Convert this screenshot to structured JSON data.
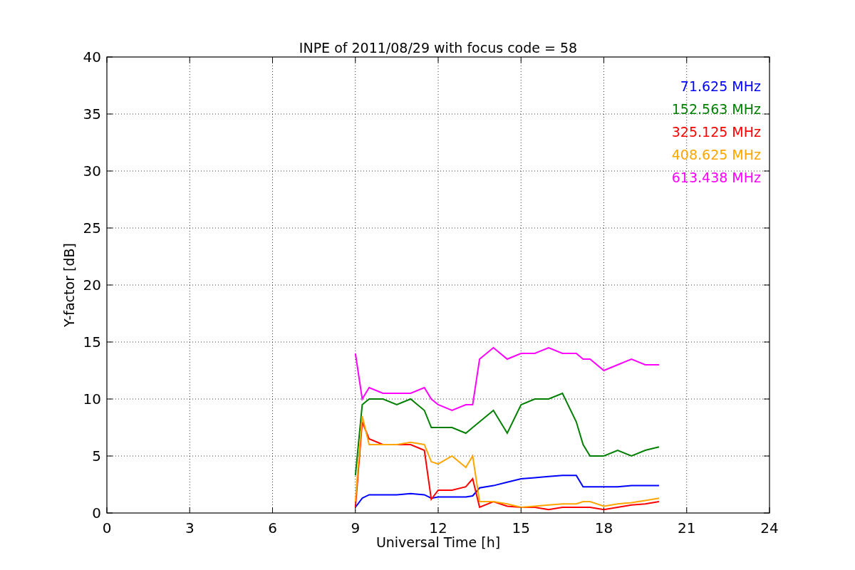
{
  "figure": {
    "chart_data": {
      "type": "line",
      "title": "INPE of 2011/08/29 with focus code = 58",
      "xlabel": "Universal Time [h]",
      "ylabel": "Y-factor [dB]",
      "x": [
        9,
        9.25,
        9.5,
        10,
        10.5,
        11,
        11.5,
        11.75,
        12,
        12.5,
        13,
        13.25,
        13.5,
        14,
        14.5,
        15,
        15.5,
        16,
        16.5,
        17,
        17.25,
        17.5,
        18,
        18.5,
        19,
        19.5,
        20
      ],
      "series": [
        {
          "name": "71.625 MHz",
          "color": "#0000ff",
          "values": [
            0.5,
            1.3,
            1.6,
            1.6,
            1.6,
            1.7,
            1.6,
            1.3,
            1.4,
            1.4,
            1.4,
            1.5,
            2.2,
            2.4,
            2.7,
            3.0,
            3.1,
            3.2,
            3.3,
            3.3,
            2.3,
            2.3,
            2.3,
            2.3,
            2.4,
            2.4,
            2.4
          ]
        },
        {
          "name": "152.563 MHz",
          "color": "#008000",
          "values": [
            3.3,
            9.5,
            10,
            10,
            9.5,
            10,
            9,
            7.5,
            7.5,
            7.5,
            7,
            7.5,
            8,
            9,
            7,
            9.5,
            10,
            10,
            10.5,
            8,
            6,
            5,
            5,
            5.5,
            5,
            5.5,
            5.8
          ]
        },
        {
          "name": "325.125 MHz",
          "color": "#ff0000",
          "values": [
            0.5,
            8,
            6.5,
            6,
            6,
            6,
            5.5,
            1.2,
            2,
            2,
            2.3,
            3,
            0.5,
            1,
            0.6,
            0.5,
            0.5,
            0.3,
            0.5,
            0.5,
            0.5,
            0.5,
            0.3,
            0.5,
            0.7,
            0.8,
            1
          ]
        },
        {
          "name": "408.625 MHz",
          "color": "#ffa500",
          "values": [
            1,
            8.5,
            6,
            6,
            6,
            6.2,
            6,
            4.5,
            4.3,
            5,
            4,
            5,
            1,
            1,
            0.8,
            0.5,
            0.6,
            0.7,
            0.8,
            0.8,
            1,
            1,
            0.6,
            0.8,
            0.9,
            1.1,
            1.3
          ]
        },
        {
          "name": "613.438 MHz",
          "color": "#ff00ff",
          "values": [
            14,
            10,
            11,
            10.5,
            10.5,
            10.5,
            11,
            10,
            9.5,
            9,
            9.5,
            9.5,
            13.5,
            14.5,
            13.5,
            14,
            14,
            14.5,
            14,
            14,
            13.5,
            13.5,
            12.5,
            13,
            13.5,
            13,
            13
          ]
        }
      ],
      "grid": true,
      "xlim": [
        0,
        24
      ],
      "ylim": [
        0,
        40
      ],
      "xticks": [
        0,
        3,
        6,
        9,
        12,
        15,
        18,
        21,
        24
      ],
      "yticks": [
        0,
        5,
        10,
        15,
        20,
        25,
        30,
        35,
        40
      ]
    }
  }
}
